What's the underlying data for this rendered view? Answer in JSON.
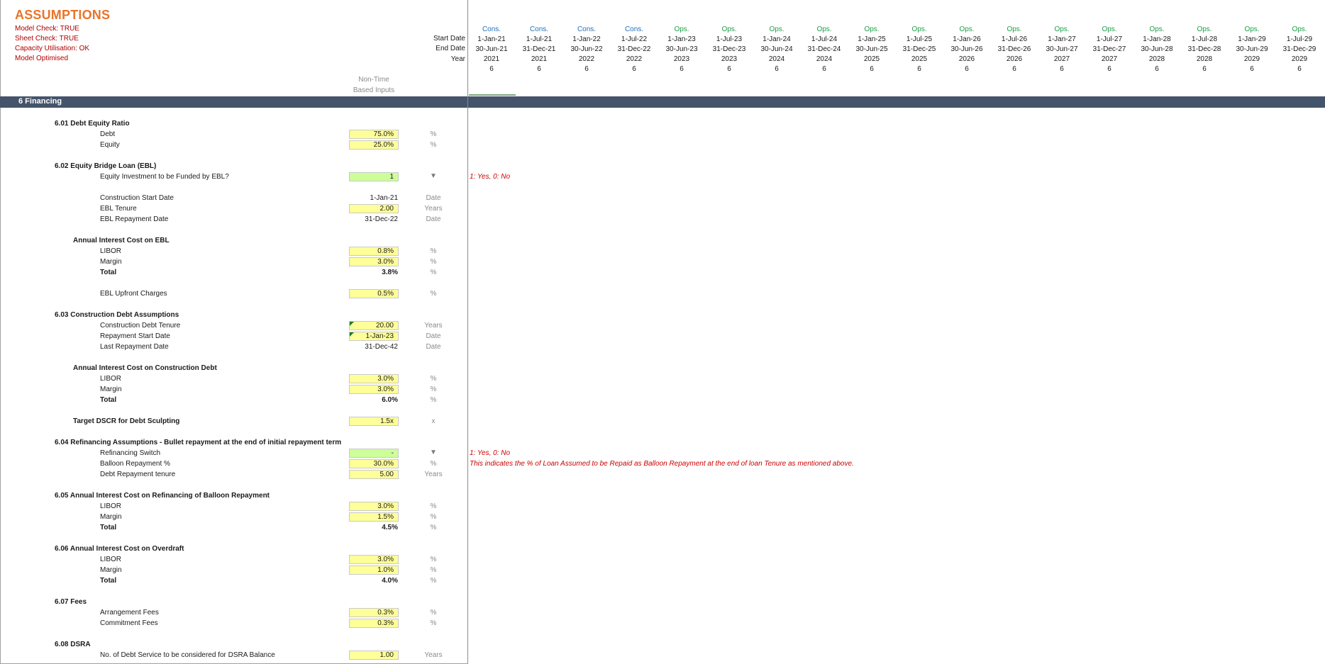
{
  "sheet": {
    "title": "ASSUMPTIONS",
    "checks": [
      "Model Check: TRUE",
      "Sheet Check: TRUE",
      "Capacity Utilisation: OK",
      "Model Optimised"
    ],
    "header_labels": {
      "start": "Start Date",
      "end": "End Date",
      "year": "Year"
    },
    "non_time_label": [
      "Non-Time",
      "Based Inputs"
    ],
    "section_band": "6  Financing"
  },
  "timeline": [
    {
      "phase": "Cons.",
      "start": "1-Jan-21",
      "end": "30-Jun-21",
      "year": "2021",
      "months": "6"
    },
    {
      "phase": "Cons.",
      "start": "1-Jul-21",
      "end": "31-Dec-21",
      "year": "2021",
      "months": "6"
    },
    {
      "phase": "Cons.",
      "start": "1-Jan-22",
      "end": "30-Jun-22",
      "year": "2022",
      "months": "6"
    },
    {
      "phase": "Cons.",
      "start": "1-Jul-22",
      "end": "31-Dec-22",
      "year": "2022",
      "months": "6"
    },
    {
      "phase": "Ops.",
      "start": "1-Jan-23",
      "end": "30-Jun-23",
      "year": "2023",
      "months": "6"
    },
    {
      "phase": "Ops.",
      "start": "1-Jul-23",
      "end": "31-Dec-23",
      "year": "2023",
      "months": "6"
    },
    {
      "phase": "Ops.",
      "start": "1-Jan-24",
      "end": "30-Jun-24",
      "year": "2024",
      "months": "6"
    },
    {
      "phase": "Ops.",
      "start": "1-Jul-24",
      "end": "31-Dec-24",
      "year": "2024",
      "months": "6"
    },
    {
      "phase": "Ops.",
      "start": "1-Jan-25",
      "end": "30-Jun-25",
      "year": "2025",
      "months": "6"
    },
    {
      "phase": "Ops.",
      "start": "1-Jul-25",
      "end": "31-Dec-25",
      "year": "2025",
      "months": "6"
    },
    {
      "phase": "Ops.",
      "start": "1-Jan-26",
      "end": "30-Jun-26",
      "year": "2026",
      "months": "6"
    },
    {
      "phase": "Ops.",
      "start": "1-Jul-26",
      "end": "31-Dec-26",
      "year": "2026",
      "months": "6"
    },
    {
      "phase": "Ops.",
      "start": "1-Jan-27",
      "end": "30-Jun-27",
      "year": "2027",
      "months": "6"
    },
    {
      "phase": "Ops.",
      "start": "1-Jul-27",
      "end": "31-Dec-27",
      "year": "2027",
      "months": "6"
    },
    {
      "phase": "Ops.",
      "start": "1-Jan-28",
      "end": "30-Jun-28",
      "year": "2028",
      "months": "6"
    },
    {
      "phase": "Ops.",
      "start": "1-Jul-28",
      "end": "31-Dec-28",
      "year": "2028",
      "months": "6"
    },
    {
      "phase": "Ops.",
      "start": "1-Jan-29",
      "end": "30-Jun-29",
      "year": "2029",
      "months": "6"
    },
    {
      "phase": "Ops.",
      "start": "1-Jul-29",
      "end": "31-Dec-29",
      "year": "2029",
      "months": "6"
    }
  ],
  "s601": {
    "title": "6.01  Debt Equity Ratio",
    "debt": "Debt",
    "debt_v": "75.0%",
    "equity": "Equity",
    "equity_v": "25.0%",
    "unit": "%"
  },
  "s602": {
    "title": "6.02  Equity Bridge Loan (EBL)",
    "q": "Equity Investment to be Funded by EBL?",
    "q_v": "1",
    "q_note": "1: Yes, 0: No",
    "csd": "Construction Start Date",
    "csd_v": "1-Jan-21",
    "ten": "EBL Tenure",
    "ten_v": "2.00",
    "rep": "EBL Repayment Date",
    "rep_v": "31-Dec-22",
    "u_date": "Date",
    "u_years": "Years",
    "u_pct": "%",
    "int_title": "Annual Interest Cost on EBL",
    "libor": "LIBOR",
    "libor_v": "0.8%",
    "margin": "Margin",
    "margin_v": "3.0%",
    "total": "Total",
    "total_v": "3.8%",
    "upfront": "EBL Upfront Charges",
    "upfront_v": "0.5%"
  },
  "s603": {
    "title": "6.03  Construction Debt Assumptions",
    "ten": "Construction Debt Tenure",
    "ten_v": "20.00",
    "rsd": "Repayment Start Date",
    "rsd_v": "1-Jan-23",
    "lrd": "Last Repayment Date",
    "lrd_v": "31-Dec-42",
    "int_title": "Annual Interest Cost on Construction Debt",
    "libor": "LIBOR",
    "libor_v": "3.0%",
    "margin": "Margin",
    "margin_v": "3.0%",
    "total": "Total",
    "total_v": "6.0%",
    "dscr": "Target DSCR for Debt Sculpting",
    "dscr_v": "1.5x",
    "dscr_u": "x"
  },
  "s604": {
    "title": "6.04  Refinancing Assumptions - Bullet repayment at the end of initial repayment term",
    "sw": "Refinancing Switch",
    "sw_v": "-",
    "sw_note": "1: Yes, 0: No",
    "bal": "Balloon Repayment %",
    "bal_v": "30.0%",
    "bal_note": "This indicates the % of Loan Assumed to be Repaid as Balloon Repayment at the end of loan Tenure as mentioned above.",
    "drt": "Debt Repayment tenure",
    "drt_v": "5.00"
  },
  "s605": {
    "title": "6.05  Annual Interest Cost on Refinancing of Balloon Repayment",
    "libor": "LIBOR",
    "libor_v": "3.0%",
    "margin": "Margin",
    "margin_v": "1.5%",
    "total": "Total",
    "total_v": "4.5%"
  },
  "s606": {
    "title": "6.06  Annual Interest Cost on Overdraft",
    "libor": "LIBOR",
    "libor_v": "3.0%",
    "margin": "Margin",
    "margin_v": "1.0%",
    "total": "Total",
    "total_v": "4.0%"
  },
  "s607": {
    "title": "6.07  Fees",
    "arr": "Arrangement Fees",
    "arr_v": "0.3%",
    "com": "Commitment Fees",
    "com_v": "0.3%"
  },
  "s608": {
    "title": "6.08  DSRA",
    "dsra": "No. of Debt Service to be considered for DSRA Balance",
    "dsra_v": "1.00"
  },
  "colors": {
    "title": "#e8742a",
    "check": "#b00000",
    "band": "#44546a",
    "input": "#ffff99",
    "switch": "#ccff99",
    "cons": "#1f6fb4",
    "ops": "#1e9e4a",
    "note": "#cc0000"
  }
}
